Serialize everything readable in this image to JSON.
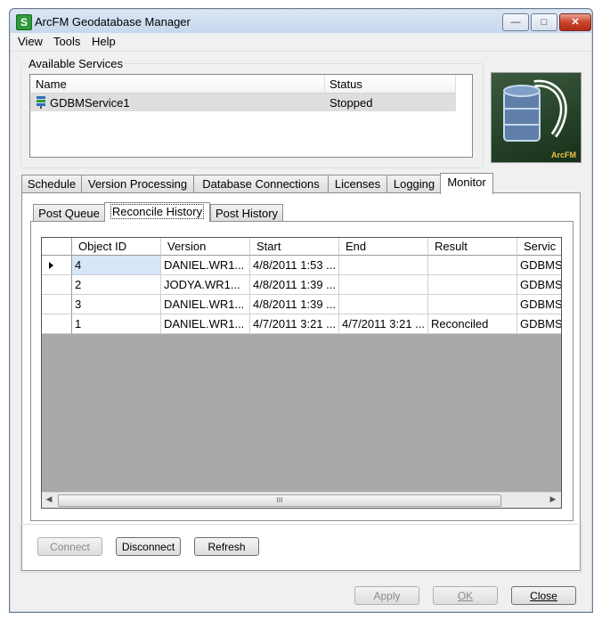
{
  "window": {
    "title": "ArcFM Geodatabase Manager"
  },
  "menu": [
    "View",
    "Tools",
    "Help"
  ],
  "services": {
    "group_label": "Available Services",
    "columns": [
      "Name",
      "Status"
    ],
    "rows": [
      {
        "name": "GDBMService1",
        "status": "Stopped"
      }
    ]
  },
  "logo": {
    "text": "ArcFM"
  },
  "tabs": [
    "Schedule",
    "Version Processing",
    "Database Connections",
    "Licenses",
    "Logging",
    "Monitor"
  ],
  "active_tab": "Monitor",
  "subtabs": [
    "Post Queue",
    "Reconcile History",
    "Post History"
  ],
  "active_subtab": "Reconcile History",
  "grid": {
    "columns": [
      "Object ID",
      "Version",
      "Start",
      "End",
      "Result",
      "Servic"
    ],
    "rows": [
      {
        "id": "4",
        "version": "DANIEL.WR1...",
        "start": "4/8/2011 1:53 ...",
        "end": "",
        "result": "",
        "service": "GDBMS"
      },
      {
        "id": "2",
        "version": "JODYA.WR1...",
        "start": "4/8/2011 1:39 ...",
        "end": "",
        "result": "",
        "service": "GDBMS"
      },
      {
        "id": "3",
        "version": "DANIEL.WR1...",
        "start": "4/8/2011 1:39 ...",
        "end": "",
        "result": "",
        "service": "GDBMS"
      },
      {
        "id": "1",
        "version": "DANIEL.WR1...",
        "start": "4/7/2011 3:21 ...",
        "end": "4/7/2011 3:21 ...",
        "result": "Reconciled",
        "service": "GDBMS"
      }
    ],
    "scroll_thumb": "III"
  },
  "buttons": {
    "connect": "Connect",
    "disconnect": "Disconnect",
    "refresh": "Refresh",
    "apply": "Apply",
    "ok": "OK",
    "close": "Close"
  }
}
